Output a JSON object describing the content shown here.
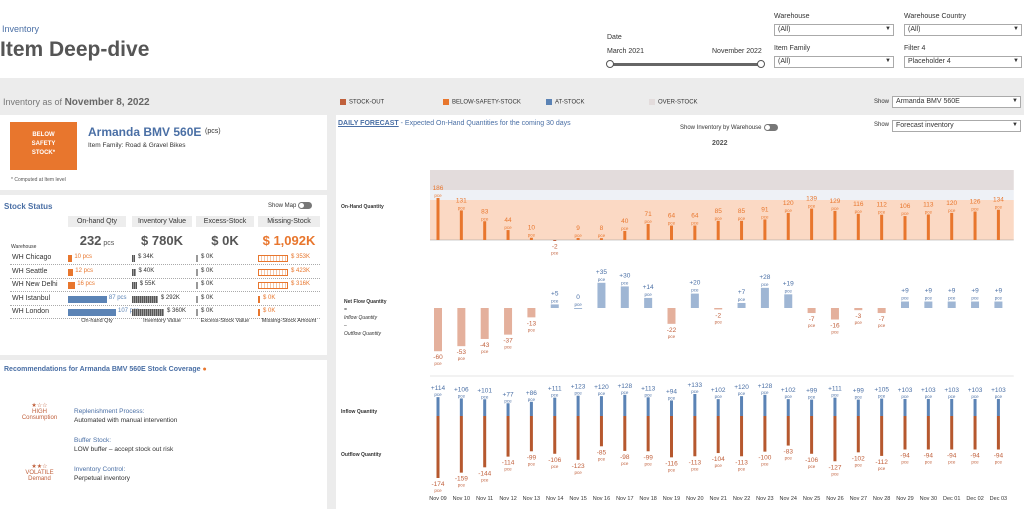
{
  "header": {
    "breadcrumb": "Inventory",
    "title": "Item Deep-dive",
    "date_label": "Date",
    "date_start": "March 2021",
    "date_end": "November 2022",
    "filters": [
      {
        "label": "Warehouse",
        "value": "(All)"
      },
      {
        "label": "Warehouse Country",
        "value": "(All)"
      },
      {
        "label": "Item Family",
        "value": "(All)"
      },
      {
        "label": "Filter 4",
        "value": "Placeholder 4"
      }
    ]
  },
  "subheader": {
    "inventory_as_of_label": "Inventory as of",
    "inventory_as_of_date": "November 8, 2022",
    "legend": [
      {
        "label": "STOCK-OUT",
        "color": "#c0603c"
      },
      {
        "label": "BELOW-SAFETY-STOCK",
        "color": "#e8762d"
      },
      {
        "label": "AT-STOCK",
        "color": "#5b83b5"
      },
      {
        "label": "OVER-STOCK",
        "color": "#e3dcdc"
      }
    ],
    "show_label": "Show",
    "show_value": "Armanda BMV 560E"
  },
  "item": {
    "status_badge": [
      "BELOW",
      "SAFETY",
      "STOCK*"
    ],
    "name": "Armanda BMV 560E",
    "unit": "(pcs)",
    "family_label": "Item Family:",
    "family_value": "Road & Gravel Bikes",
    "footnote": "* Computed at Item level"
  },
  "stock_status": {
    "title": "Stock Status",
    "show_map": "Show Map",
    "columns": [
      "On-hand Qty",
      "Inventory Value",
      "Excess-Stock",
      "Missing-Stock"
    ],
    "totals": {
      "onhand": "232",
      "onhand_unit": "pcs",
      "value": "$ 780K",
      "excess": "$ 0K",
      "missing": "$ 1,092K"
    },
    "warehouse_label": "Warehouse",
    "rows": [
      {
        "name": "WH Chicago",
        "qty": "10 pcs",
        "value": "$ 34K",
        "excess": "$ 0K",
        "missing": "$ 353K",
        "qty_color": "#e8762d",
        "qty_frac": 0.09,
        "value_frac": 0.09,
        "missing_frac": 1.0,
        "missing_color": "#e8762d"
      },
      {
        "name": "WH Seattle",
        "qty": "12 pcs",
        "value": "$ 40K",
        "excess": "$ 0K",
        "missing": "$ 423K",
        "qty_color": "#e8762d",
        "qty_frac": 0.11,
        "value_frac": 0.11,
        "missing_frac": 1.0,
        "missing_color": "#e8762d"
      },
      {
        "name": "WH New Delhi",
        "qty": "16 pcs",
        "value": "$ 55K",
        "excess": "$ 0K",
        "missing": "$ 316K",
        "qty_color": "#e8762d",
        "qty_frac": 0.15,
        "value_frac": 0.15,
        "missing_frac": 1.0,
        "missing_color": "#e8762d"
      },
      {
        "name": "WH Istanbul",
        "qty": "87 pcs",
        "value": "$ 292K",
        "excess": "$ 0K",
        "missing": "$ 0K",
        "qty_color": "#5b83b5",
        "qty_frac": 0.81,
        "value_frac": 0.81,
        "missing_frac": 0.0,
        "missing_color": "#e8762d"
      },
      {
        "name": "WH London",
        "qty": "107 pcs",
        "value": "$ 360K",
        "excess": "$ 0K",
        "missing": "$ 0K",
        "qty_color": "#5b83b5",
        "qty_frac": 1.0,
        "value_frac": 1.0,
        "missing_frac": 0.0,
        "missing_color": "#e8762d"
      }
    ],
    "footer_cols": [
      "On-hand Qty",
      "Inventory Value",
      "Excess-Stock Value",
      "Missing-Stock Amount"
    ]
  },
  "recommendations": {
    "title": "Recommendations for Armanda BMV 560E Stock Coverage",
    "groups": [
      {
        "stars": "★☆☆",
        "level": "HIGH",
        "kind": "Consumption"
      },
      {
        "stars": "★★☆",
        "level": "VOLATILE",
        "kind": "Demand"
      }
    ],
    "items": [
      {
        "title": "Replenishment Process:",
        "value": "Automated with manual intervention"
      },
      {
        "title": "Buffer Stock:",
        "value": "LOW buffer – accept stock out risk"
      },
      {
        "title": "Inventory Control:",
        "value": "Perpetual inventory"
      }
    ]
  },
  "forecast": {
    "title_link": "DAILY FORECAST",
    "title_rest": " - Expected On-Hand Quantities for the coming 30 days",
    "show_by_wh": "Show Inventory by Warehouse",
    "show_label": "Show",
    "show_value": "Forecast inventory",
    "year": "2022",
    "row_labels": {
      "onhand": "On-Hand Quantity",
      "netflow": "Net Flow Quantity",
      "netflow_sub1": "=",
      "netflow_sub2": "Inflow Quantity",
      "netflow_sub3": "–",
      "netflow_sub4": "Outflow Quantity",
      "inflow": "Inflow Quantity",
      "outflow": "Outflow Quantity"
    },
    "unit": "pce"
  },
  "chart_data": {
    "type": "bar",
    "categories": [
      "Nov 09",
      "Nov 10",
      "Nov 11",
      "Nov 12",
      "Nov 13",
      "Nov 14",
      "Nov 15",
      "Nov 16",
      "Nov 17",
      "Nov 18",
      "Nov 19",
      "Nov 20",
      "Nov 21",
      "Nov 22",
      "Nov 23",
      "Nov 24",
      "Nov 25",
      "Nov 26",
      "Nov 27",
      "Nov 28",
      "Nov 29",
      "Nov 30",
      "Dec 01",
      "Dec 02",
      "Dec 03"
    ],
    "onhand": [
      186,
      131,
      83,
      44,
      10,
      -2,
      9,
      8,
      40,
      71,
      64,
      64,
      85,
      85,
      91,
      120,
      139,
      129,
      116,
      112,
      106,
      113,
      120,
      126,
      134
    ],
    "onhand_labels": [
      "186",
      "131",
      "83",
      "44",
      "10",
      "-2",
      "9",
      "8",
      "40",
      "71",
      "64",
      "64",
      "85",
      "85",
      "91",
      "120",
      "139",
      "129",
      "116",
      "112",
      "106",
      "113",
      "120",
      "126",
      "134"
    ],
    "netflow": [
      -60,
      -53,
      -43,
      -37,
      -13,
      5,
      0,
      35,
      30,
      14,
      -22,
      20,
      -2,
      7,
      28,
      19,
      -7,
      -16,
      -3,
      -7,
      9,
      9,
      9,
      9,
      9
    ],
    "netflow_labels": [
      "-60",
      "-53",
      "-43",
      "-37",
      "-13",
      "+5",
      "0",
      "+35",
      "+30",
      "+14",
      "-22",
      "+20",
      "-2",
      "+7",
      "+28",
      "+19",
      "-7",
      "-16",
      "-3",
      "-7",
      "+9",
      "+9",
      "+9",
      "+9",
      "+9"
    ],
    "inflow": [
      114,
      106,
      101,
      77,
      86,
      111,
      123,
      120,
      128,
      113,
      94,
      133,
      102,
      120,
      128,
      102,
      99,
      111,
      99,
      105,
      103,
      103,
      103,
      103,
      103
    ],
    "inflow_labels": [
      "+114",
      "+106",
      "+101",
      "+77",
      "+86",
      "+111",
      "+123",
      "+120",
      "+128",
      "+113",
      "+94",
      "+133",
      "+102",
      "+120",
      "+128",
      "+102",
      "+99",
      "+111",
      "+99",
      "+105",
      "+103",
      "+103",
      "+103",
      "+103",
      "+103"
    ],
    "outflow": [
      -174,
      -159,
      -144,
      -114,
      -99,
      -106,
      -123,
      -85,
      -98,
      -99,
      -116,
      -113,
      -104,
      -113,
      -100,
      -83,
      -106,
      -127,
      -102,
      -112,
      -94,
      -94,
      -94,
      -94,
      -94
    ],
    "outflow_labels": [
      "-174",
      "-159",
      "-144",
      "-114",
      "-99",
      "-106",
      "-123",
      "-85",
      "-98",
      "-99",
      "-116",
      "-113",
      "-104",
      "-113",
      "-100",
      "-83",
      "-106",
      "-127",
      "-102",
      "-112",
      "-94",
      "-94",
      "-94",
      "-94",
      "-94"
    ],
    "colors": {
      "below": "#e8762d",
      "below_fill": "#fbd9c4",
      "at": "#5b83b5",
      "over": "#e3dcdc",
      "stockout": "#c0603c",
      "netneg": "#e4b09c",
      "netpos": "#9fb6d4",
      "outflow": "#b6582e",
      "inflow": "#5b83b5"
    }
  }
}
